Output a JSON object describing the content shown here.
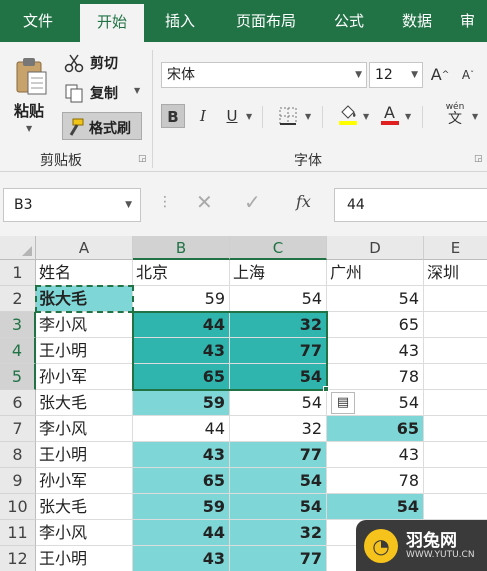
{
  "ribbon": {
    "tabs": [
      "文件",
      "开始",
      "插入",
      "页面布局",
      "公式",
      "数据",
      "审"
    ],
    "active_tab": "开始",
    "clipboard": {
      "group_label": "剪贴板",
      "paste": "粘贴",
      "cut": "剪切",
      "copy": "复制",
      "format_painter": "格式刷"
    },
    "font": {
      "group_label": "字体",
      "font_name": "宋体",
      "font_size": "12",
      "bold": "B",
      "italic": "I",
      "underline": "U",
      "grow": "A",
      "shrink": "A",
      "phonetic_top": "wén",
      "phonetic_bottom": "文"
    }
  },
  "formula_bar": {
    "name_box": "B3",
    "fx": "fx",
    "value": "44"
  },
  "sheet": {
    "columns": [
      "A",
      "B",
      "C",
      "D",
      "E"
    ],
    "selected_columns": [
      "B",
      "C"
    ],
    "rows": [
      {
        "num": "1",
        "cells": [
          "姓名",
          "北京",
          "上海",
          "广州",
          "深圳"
        ]
      },
      {
        "num": "2",
        "cells": [
          "张大毛",
          "59",
          "54",
          "54",
          ""
        ]
      },
      {
        "num": "3",
        "cells": [
          "李小风",
          "44",
          "32",
          "65",
          ""
        ]
      },
      {
        "num": "4",
        "cells": [
          "王小明",
          "43",
          "77",
          "43",
          ""
        ]
      },
      {
        "num": "5",
        "cells": [
          "孙小军",
          "65",
          "54",
          "78",
          ""
        ]
      },
      {
        "num": "6",
        "cells": [
          "张大毛",
          "59",
          "54",
          "54",
          ""
        ]
      },
      {
        "num": "7",
        "cells": [
          "李小风",
          "44",
          "32",
          "65",
          ""
        ]
      },
      {
        "num": "8",
        "cells": [
          "王小明",
          "43",
          "77",
          "43",
          ""
        ]
      },
      {
        "num": "9",
        "cells": [
          "孙小军",
          "65",
          "54",
          "78",
          ""
        ]
      },
      {
        "num": "10",
        "cells": [
          "张大毛",
          "59",
          "54",
          "54",
          ""
        ]
      },
      {
        "num": "11",
        "cells": [
          "李小风",
          "44",
          "32",
          "",
          ""
        ]
      },
      {
        "num": "12",
        "cells": [
          "王小明",
          "43",
          "77",
          "",
          ""
        ]
      }
    ]
  },
  "colors": {
    "brand": "#217346",
    "highlight_cyan": "#7fd6d6",
    "selection_fill": "#2fb5ad"
  },
  "watermark": {
    "name": "羽兔网",
    "url": "WWW.YUTU.CN"
  }
}
